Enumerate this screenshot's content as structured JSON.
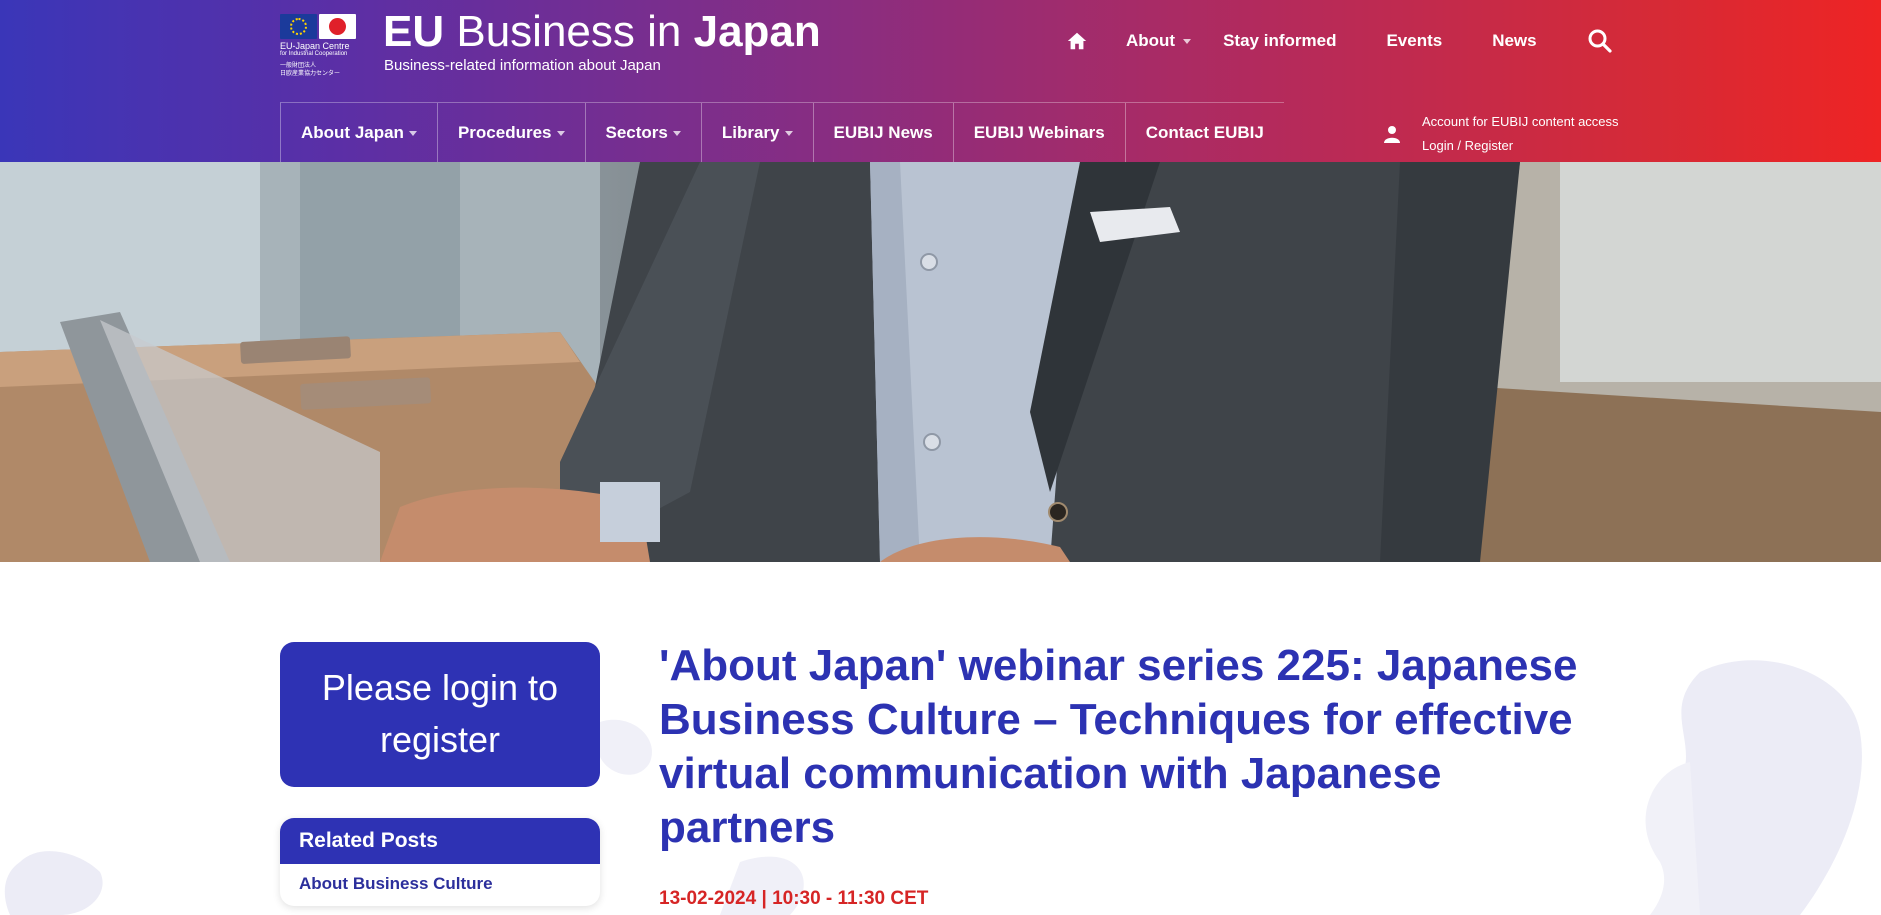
{
  "brand": {
    "logo_line1": "EU-Japan Centre",
    "logo_line2": "for Industrial Cooperation",
    "logo_jp1": "一般財団法人",
    "logo_jp2": "日欧産業協力センター",
    "title_bold": "EU",
    "title_light": "Business in",
    "title_bold2": "Japan",
    "tagline": "Business-related information about Japan"
  },
  "top_nav": {
    "home_icon": "home-icon",
    "items": [
      "About",
      "Stay informed",
      "Events",
      "News"
    ],
    "search_icon": "search-icon"
  },
  "main_nav": {
    "items": [
      "About Japan",
      "Procedures",
      "Sectors",
      "Library",
      "EUBIJ News",
      "EUBIJ Webinars",
      "Contact EUBIJ"
    ]
  },
  "account": {
    "icon": "user-icon",
    "line1": "Account for EUBIJ content access",
    "line2": "Login / Register"
  },
  "sidebar": {
    "login_button": "Please login to register",
    "related_title": "Related Posts",
    "related_items": [
      "About Business Culture"
    ]
  },
  "post": {
    "title": "'About Japan' webinar series 225: Japanese Business Culture – Techniques for effective virtual communication with Japanese partners",
    "date": "13-02-2024 | 10:30 - 11:30 CET"
  },
  "colors": {
    "accent": "#2e32b4",
    "date_red": "#d62525",
    "header_start": "#3a36b8",
    "header_end": "#ee2424"
  }
}
